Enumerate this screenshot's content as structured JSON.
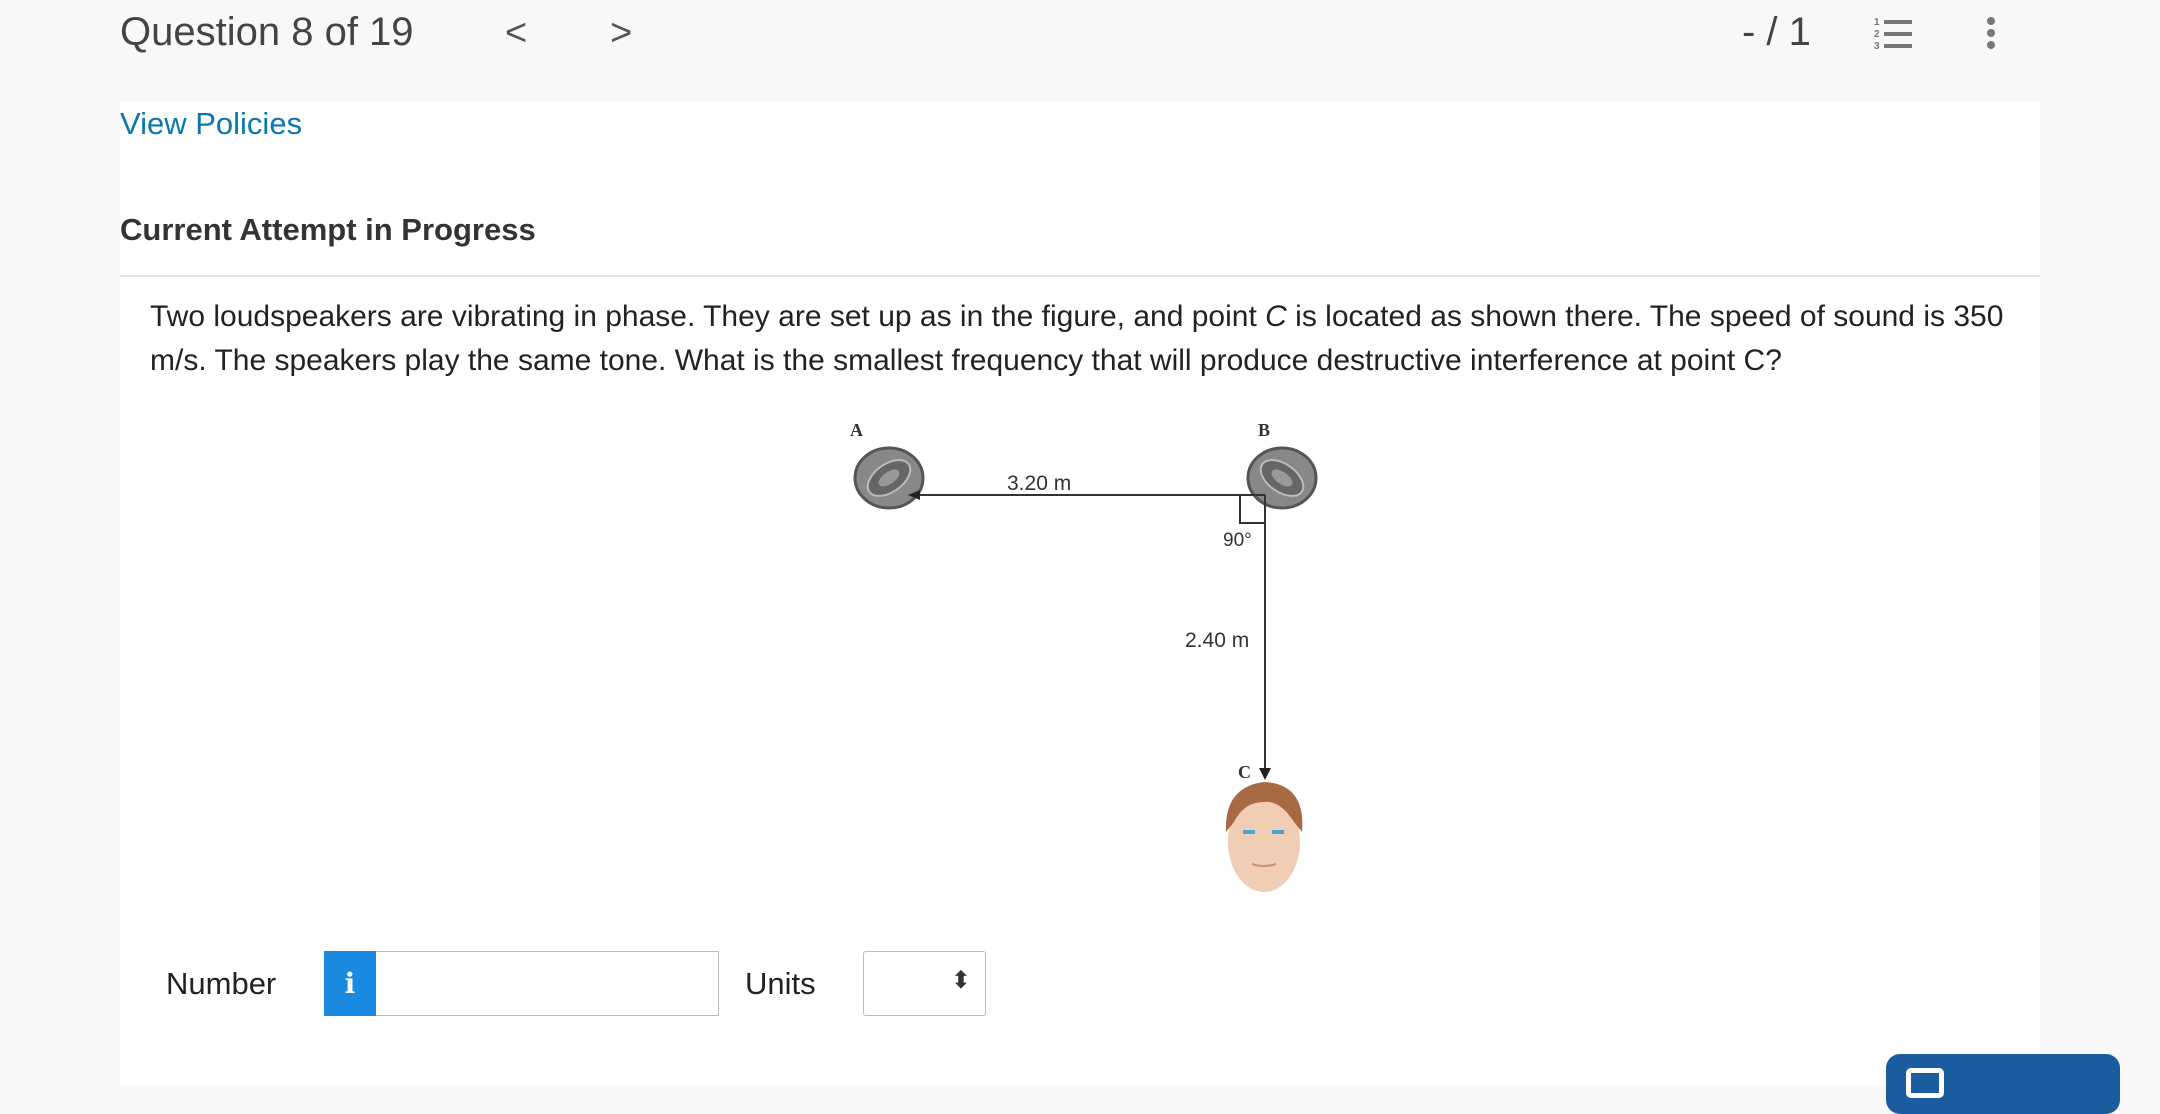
{
  "header": {
    "question_title": "Question 8 of 19",
    "prev_icon": "chevron-left-icon",
    "next_icon": "chevron-right-icon",
    "prev_label": "<",
    "next_label": ">",
    "score": "- / 1",
    "list_icon": "numbered-list-icon",
    "more_icon": "vertical-ellipsis-icon"
  },
  "main": {
    "view_policies": "View Policies",
    "attempt_status": "Current Attempt in Progress",
    "question_text_1": "Two loudspeakers are vibrating in phase. They are set up as in the figure, and point ",
    "question_point": "C",
    "question_text_2": " is located as shown there. The speed of sound is 350 m/s. The speakers play the same tone. What is the smallest frequency that will produce destructive interference at point C?",
    "figure": {
      "label_a": "A",
      "label_b": "B",
      "label_c": "C",
      "distance_ab": "3.20 m",
      "distance_bc": "2.40 m",
      "angle": "90°"
    },
    "answer": {
      "number_label": "Number",
      "info_label": "i",
      "number_value": "",
      "units_label": "Units",
      "units_value": "",
      "units_icon": "up-down-chevron-icon"
    }
  },
  "colors": {
    "link": "#0a77b0",
    "info_button": "#1a8ae0",
    "primary_button": "#1b5c9e"
  }
}
